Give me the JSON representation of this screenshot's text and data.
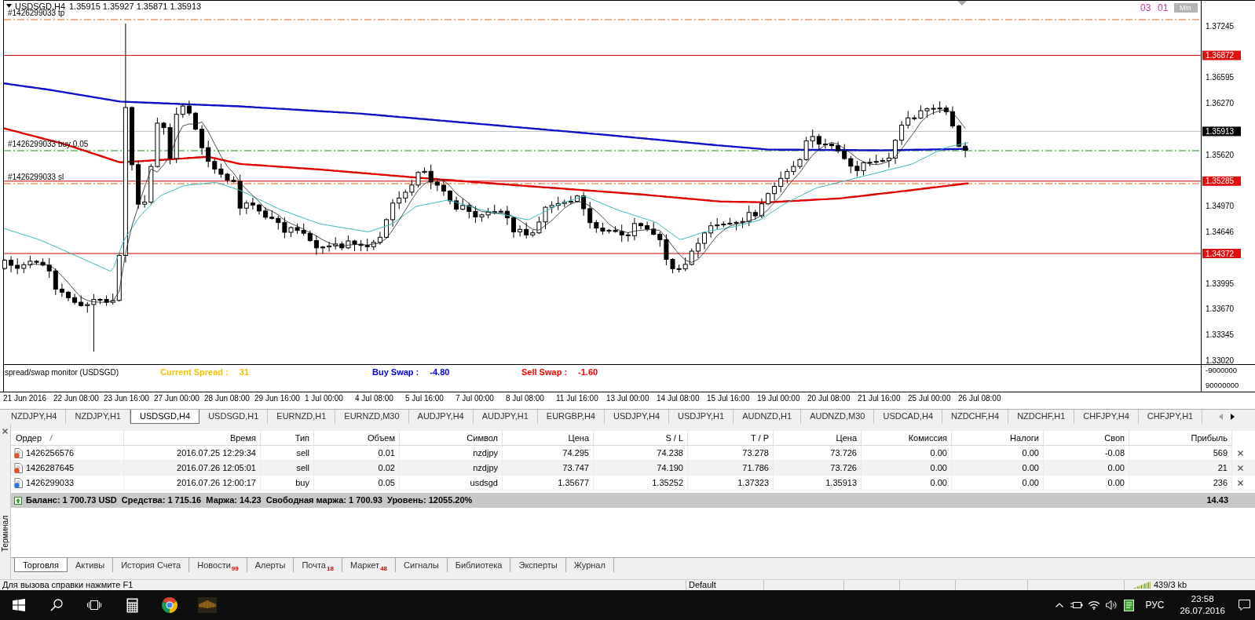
{
  "chart": {
    "symbol": "USDSGD,H4",
    "ohlc": "1.35915 1.35927 1.35871 1.35913",
    "corner_values": [
      "03",
      "01"
    ],
    "minimize_button": "Min",
    "order_labels": [
      {
        "text": "#1426299033 tp",
        "kind": "tp"
      },
      {
        "text": "#1426299033 buy 0.05",
        "kind": "open"
      },
      {
        "text": "#1426299033 sl",
        "kind": "sl"
      }
    ],
    "price_axis": [
      {
        "text": "1.37245",
        "kind": "tick"
      },
      {
        "text": "1.36872",
        "kind": "level"
      },
      {
        "text": "1.36595",
        "kind": "tick"
      },
      {
        "text": "1.36270",
        "kind": "tick"
      },
      {
        "text": "1.35913",
        "kind": "bid"
      },
      {
        "text": "1.35620",
        "kind": "tick"
      },
      {
        "text": "1.35285",
        "kind": "level"
      },
      {
        "text": "1.34970",
        "kind": "tick"
      },
      {
        "text": "1.34646",
        "kind": "tick"
      },
      {
        "text": "1.34372",
        "kind": "level"
      },
      {
        "text": "1.33995",
        "kind": "tick"
      },
      {
        "text": "1.33670",
        "kind": "tick"
      },
      {
        "text": "1.33345",
        "kind": "tick"
      },
      {
        "text": "1.33020",
        "kind": "tick"
      }
    ]
  },
  "indicator": {
    "title": "spread/swap monitor (USDSGD)",
    "readings": [
      {
        "label": "Current Spread :",
        "value": "31",
        "color": "#f2c200"
      },
      {
        "label": "Buy Swap :",
        "value": "-4.80",
        "color": "#0000e0"
      },
      {
        "label": "Sell Swap :",
        "value": "-1.60",
        "color": "#ff0000"
      }
    ],
    "axis": [
      "-9000000",
      "90000000"
    ]
  },
  "time_axis": [
    "21 Jun 2016",
    "22 Jun 08:00",
    "23 Jun 16:00",
    "27 Jun 00:00",
    "28 Jun 08:00",
    "29 Jun 16:00",
    "1 Jul 00:00",
    "4 Jul 08:00",
    "5 Jul 16:00",
    "7 Jul 00:00",
    "8 Jul 08:00",
    "11 Jul 16:00",
    "13 Jul 00:00",
    "14 Jul 08:00",
    "15 Jul 16:00",
    "19 Jul 00:00",
    "20 Jul 08:00",
    "21 Jul 16:00",
    "25 Jul 00:00",
    "26 Jul 08:00"
  ],
  "symbol_tabs": [
    {
      "label": "NZDJPY,H4",
      "selected": false
    },
    {
      "label": "NZDJPY,H1",
      "selected": false
    },
    {
      "label": "USDSGD,H4",
      "selected": true
    },
    {
      "label": "USDSGD,H1",
      "selected": false
    },
    {
      "label": "EURNZD,H1",
      "selected": false
    },
    {
      "label": "EURNZD,M30",
      "selected": false
    },
    {
      "label": "AUDJPY,H4",
      "selected": false
    },
    {
      "label": "AUDJPY,H1",
      "selected": false
    },
    {
      "label": "EURGBP,H4",
      "selected": false
    },
    {
      "label": "USDJPY,H4",
      "selected": false
    },
    {
      "label": "USDJPY,H1",
      "selected": false
    },
    {
      "label": "AUDNZD,H1",
      "selected": false
    },
    {
      "label": "AUDNZD,M30",
      "selected": false
    },
    {
      "label": "USDCAD,H4",
      "selected": false
    },
    {
      "label": "NZDCHF,H4",
      "selected": false
    },
    {
      "label": "NZDCHF,H1",
      "selected": false
    },
    {
      "label": "CHFJPY,H4",
      "selected": false
    },
    {
      "label": "CHFJPY,H1",
      "selected": false
    }
  ],
  "terminal": {
    "title": "Терминал",
    "columns": [
      "Ордер",
      "Время",
      "Тип",
      "Объем",
      "Символ",
      "Цена",
      "S / L",
      "T / P",
      "Цена",
      "Комиссия",
      "Налоги",
      "Своп",
      "Прибыль"
    ],
    "rows": [
      {
        "kind": "sell",
        "cells": [
          "1426256576",
          "2016.07.25 12:29:34",
          "sell",
          "0.01",
          "nzdjpy",
          "74.295",
          "74.238",
          "73.278",
          "73.726",
          "0.00",
          "0.00",
          "-0.08",
          "569"
        ]
      },
      {
        "kind": "sell",
        "cells": [
          "1426287645",
          "2016.07.26 12:05:01",
          "sell",
          "0.02",
          "nzdjpy",
          "73.747",
          "74.190",
          "71.786",
          "73.726",
          "0.00",
          "0.00",
          "0.00",
          "21"
        ]
      },
      {
        "kind": "buy",
        "cells": [
          "1426299033",
          "2016.07.26 12:00:17",
          "buy",
          "0.05",
          "usdsgd",
          "1.35677",
          "1.35252",
          "1.37323",
          "1.35913",
          "0.00",
          "0.00",
          "0.00",
          "236"
        ]
      }
    ],
    "summary": {
      "text": "Баланс: 1 700.73 USD  Средства: 1 715.16  Маржа: 14.23  Свободная маржа: 1 700.93  Уровень: 12055.20%",
      "profit": "14.43"
    },
    "tabs": [
      {
        "label": "Торговля",
        "selected": true
      },
      {
        "label": "Активы",
        "selected": false
      },
      {
        "label": "История Счета",
        "selected": false
      },
      {
        "label": "Новости",
        "badge": "99",
        "selected": false
      },
      {
        "label": "Алерты",
        "selected": false
      },
      {
        "label": "Почта",
        "badge": "18",
        "selected": false
      },
      {
        "label": "Маркет",
        "badge": "48",
        "selected": false
      },
      {
        "label": "Сигналы",
        "selected": false
      },
      {
        "label": "Библиотека",
        "selected": false
      },
      {
        "label": "Эксперты",
        "selected": false
      },
      {
        "label": "Журнал",
        "selected": false
      }
    ]
  },
  "status_bar": {
    "help": "Для вызова справки нажмите F1",
    "profile": "Default",
    "traffic": "439/3 kb"
  },
  "taskbar": {
    "language": "РУС",
    "time": "23:58",
    "date": "26.07.2016"
  }
}
